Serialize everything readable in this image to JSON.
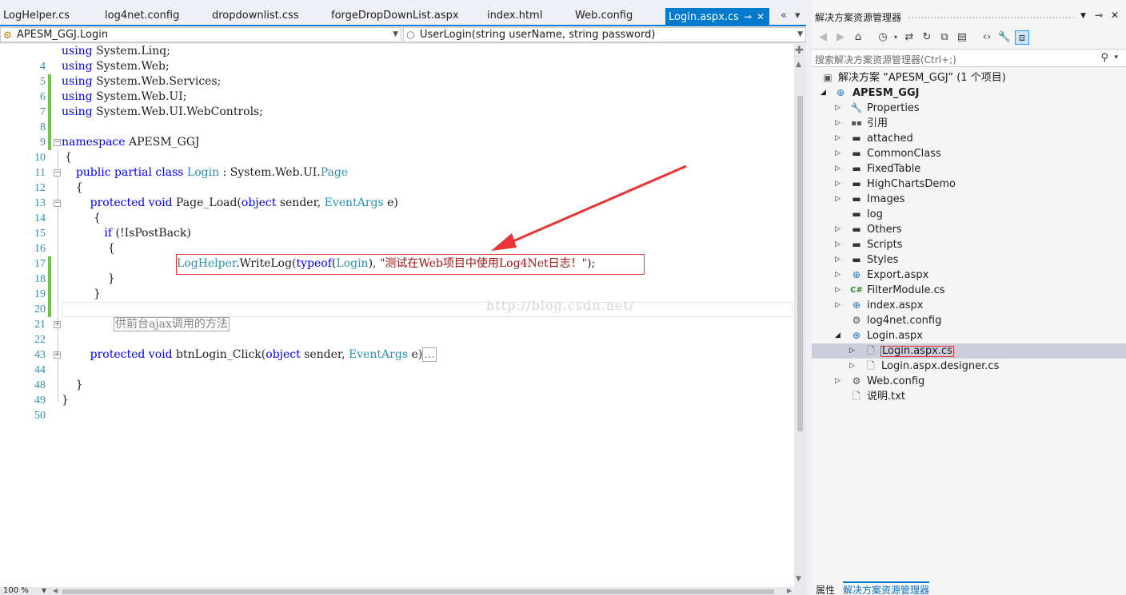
{
  "tabs": [
    {
      "label": "LogHelper.cs"
    },
    {
      "label": "log4net.config"
    },
    {
      "label": "dropdownlist.css"
    },
    {
      "label": "forgeDropDownList.aspx"
    },
    {
      "label": "index.html"
    },
    {
      "label": "Web.config"
    },
    {
      "label": "Login.aspx.cs",
      "active": true
    }
  ],
  "nav": {
    "class_combo": "APESM_GGJ.Login",
    "member_combo": "UserLogin(string userName, string password)"
  },
  "editor": {
    "lines": [
      {
        "n": "4",
        "code": "using System.Linq;"
      },
      {
        "n": "5",
        "code": "using System.Web;"
      },
      {
        "n": "6",
        "code": "using System.Web.Services;"
      },
      {
        "n": "7",
        "code": "using System.Web.UI;"
      },
      {
        "n": "8",
        "code": "using System.Web.UI.WebControls;"
      },
      {
        "n": "9",
        "code": ""
      },
      {
        "n": "10",
        "code": "namespace APESM_GGJ"
      },
      {
        "n": "11",
        "code": "{"
      },
      {
        "n": "12",
        "code": "public partial class Login : System.Web.UI.Page"
      },
      {
        "n": "13",
        "code": "{"
      },
      {
        "n": "14",
        "code": "protected void Page_Load(object sender, EventArgs e)"
      },
      {
        "n": "15",
        "code": "{"
      },
      {
        "n": "16",
        "code": "if (!IsPostBack)"
      },
      {
        "n": "17",
        "code": "{"
      },
      {
        "n": "18",
        "code": "LogHelper.WriteLog(typeof(Login), \"测试在Web项目中使用Log4Net日志！\");"
      },
      {
        "n": "19",
        "code": "}"
      },
      {
        "n": "20",
        "code": "}"
      },
      {
        "n": "21",
        "code": ""
      },
      {
        "n": "22",
        "code": "供前台ajax调用的方法"
      },
      {
        "n": "43",
        "code": ""
      },
      {
        "n": "44",
        "code": "protected void btnLogin_Click(object sender, EventArgs e)..."
      },
      {
        "n": "48",
        "code": ""
      },
      {
        "n": "49",
        "code": "}"
      },
      {
        "n": "50",
        "code": "}"
      }
    ],
    "watermark": "http://blog.csdn.net/",
    "collapsed_region": "供前台ajax调用的方法",
    "collapsed_ellipsis": "...",
    "zoom": "100 %"
  },
  "solution_explorer": {
    "title": "解决方案资源管理器",
    "search_placeholder": "搜索解决方案资源管理器(Ctrl+;)",
    "toolbar_icons": [
      "back-icon",
      "forward-icon",
      "home-icon",
      "history-icon",
      "sync-icon",
      "refresh-icon",
      "collapse-all-icon",
      "show-all-files-icon",
      "view-code-icon",
      "properties-icon",
      "preview-icon"
    ],
    "items": [
      {
        "label": "解决方案 “APESM_GGJ” (1 个项目)",
        "icon": "solution-icon"
      },
      {
        "label": "APESM_GGJ",
        "icon": "web-project-icon"
      },
      {
        "label": "Properties",
        "icon": "wrench-icon"
      },
      {
        "label": "引用",
        "icon": "references-icon"
      },
      {
        "label": "attached",
        "icon": "folder-icon"
      },
      {
        "label": "CommonClass",
        "icon": "folder-icon"
      },
      {
        "label": "FixedTable",
        "icon": "folder-icon"
      },
      {
        "label": "HighChartsDemo",
        "icon": "folder-icon"
      },
      {
        "label": "Images",
        "icon": "folder-icon"
      },
      {
        "label": "log",
        "icon": "folder-icon"
      },
      {
        "label": "Others",
        "icon": "folder-icon"
      },
      {
        "label": "Scripts",
        "icon": "folder-icon"
      },
      {
        "label": "Styles",
        "icon": "folder-icon"
      },
      {
        "label": "Export.aspx",
        "icon": "web-form-icon"
      },
      {
        "label": "FilterModule.cs",
        "icon": "csharp-file-icon"
      },
      {
        "label": "index.aspx",
        "icon": "web-form-icon"
      },
      {
        "label": "log4net.config",
        "icon": "config-icon"
      },
      {
        "label": "Login.aspx",
        "icon": "web-form-icon"
      },
      {
        "label": "Login.aspx.cs",
        "icon": "code-file-icon",
        "selected": true
      },
      {
        "label": "Login.aspx.designer.cs",
        "icon": "code-file-icon"
      },
      {
        "label": "Web.config",
        "icon": "config-icon"
      },
      {
        "label": "说明.txt",
        "icon": "text-file-icon"
      }
    ],
    "bottom_tabs": [
      "属性",
      "解决方案资源管理器"
    ]
  },
  "colors": {
    "accent": "#007acc",
    "keyword": "#0000ff",
    "type": "#2b91af",
    "string": "#a31515",
    "annotation_red": "#e03030"
  }
}
